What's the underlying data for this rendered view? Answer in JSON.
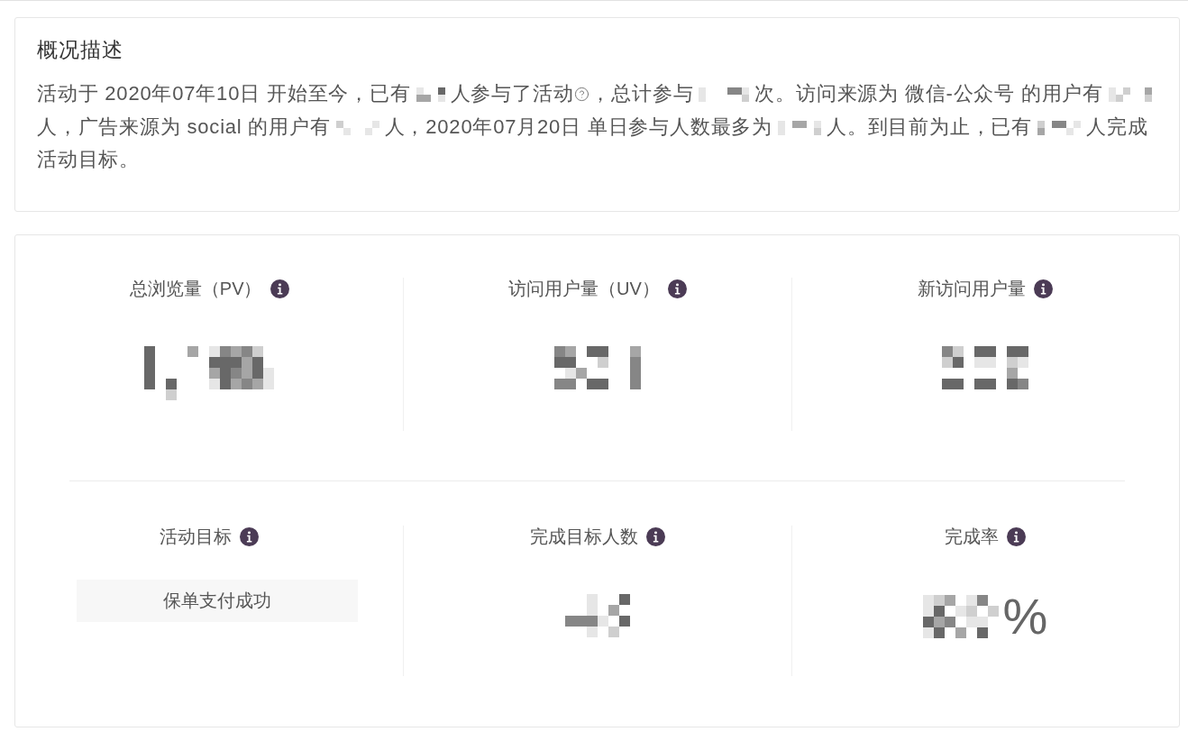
{
  "summary": {
    "title": "概况描述",
    "segments": [
      {
        "kind": "text",
        "text": "活动于 2020年07年10日 开始至今，已有"
      },
      {
        "kind": "redacted"
      },
      {
        "kind": "text",
        "text": "人参与了活动"
      },
      {
        "kind": "help"
      },
      {
        "kind": "text",
        "text": "，总计参与"
      },
      {
        "kind": "redacted"
      },
      {
        "kind": "text",
        "text": "次。访问来源为 微信-公众号 的用户有"
      },
      {
        "kind": "redacted"
      },
      {
        "kind": "text",
        "text": "人，广告来源为 social 的用户有"
      },
      {
        "kind": "redacted"
      },
      {
        "kind": "text",
        "text": "人，2020年07月20日 单日参与人数最多为"
      },
      {
        "kind": "redacted"
      },
      {
        "kind": "text",
        "text": "人。到目前为止，已有"
      },
      {
        "kind": "redacted"
      },
      {
        "kind": "text",
        "text": "人完成活动目标。"
      }
    ]
  },
  "overview": {
    "rows": [
      {
        "metrics": [
          {
            "label": "总浏览量（PV）",
            "kind": "pixelated"
          },
          {
            "label": "访问用户量（UV）",
            "kind": "pixelated"
          },
          {
            "label": "新访问用户量",
            "kind": "pixelated"
          }
        ]
      },
      {
        "metrics": [
          {
            "label": "活动目标",
            "kind": "goal",
            "value": "保单支付成功"
          },
          {
            "label": "完成目标人数",
            "kind": "pixelated"
          },
          {
            "label": "完成率",
            "kind": "pixelated",
            "unit": "%"
          }
        ]
      }
    ]
  }
}
